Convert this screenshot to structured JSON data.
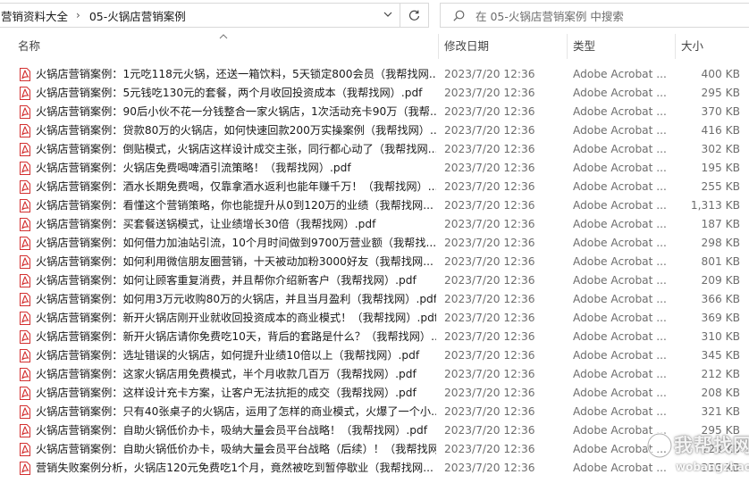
{
  "address_bar": {
    "segments": [
      "营销资料大全",
      "05-火锅店营销案例"
    ],
    "separator": "›"
  },
  "search": {
    "placeholder": "在 05-火锅店营销案例 中搜索"
  },
  "columns": {
    "name": "名称",
    "date": "修改日期",
    "type": "类型",
    "size": "大小"
  },
  "colors": {
    "pdf_icon": "#d32f2f",
    "header_text": "#444444",
    "meta_text": "#6d6d6d"
  },
  "files": [
    {
      "name": "火锅店营销案例：1元吃118元火锅，还送一箱饮料，5天锁定800会员（我帮找网...",
      "date": "2023/7/20 12:36",
      "type": "Adobe Acrobat ...",
      "size": "400 KB"
    },
    {
      "name": "火锅店营销案例：5元钱吃130元的套餐，两个月收回投资成本（我帮找网）.pdf",
      "date": "2023/7/20 12:36",
      "type": "Adobe Acrobat ...",
      "size": "295 KB"
    },
    {
      "name": "火锅店营销案例：90后小伙不花一分钱整合一家火锅店，1次活动充卡90万（我帮...",
      "date": "2023/7/20 12:36",
      "type": "Adobe Acrobat ...",
      "size": "370 KB"
    },
    {
      "name": "火锅店营销案例：贷款80万的火锅店，如何快速回款200万实操案例（我帮找网）....",
      "date": "2023/7/20 12:36",
      "type": "Adobe Acrobat ...",
      "size": "416 KB"
    },
    {
      "name": "火锅店营销案例：倒贴模式，火锅店这样设计成交主张，同行都心动了（我帮找网...",
      "date": "2023/7/20 12:36",
      "type": "Adobe Acrobat ...",
      "size": "302 KB"
    },
    {
      "name": "火锅店营销案例：火锅店免费喝啤酒引流策略！（我帮找网）.pdf",
      "date": "2023/7/20 12:36",
      "type": "Adobe Acrobat ...",
      "size": "195 KB"
    },
    {
      "name": "火锅店营销案例：酒水长期免费喝，仅靠拿酒水返利也能年赚千万！（我帮找网）...",
      "date": "2023/7/20 12:36",
      "type": "Adobe Acrobat ...",
      "size": "255 KB"
    },
    {
      "name": "火锅店营销案例：看懂这个营销策略，你也能提升从0到120万的业绩（我帮找网...",
      "date": "2023/7/20 12:36",
      "type": "Adobe Acrobat ...",
      "size": "1,313 KB"
    },
    {
      "name": "火锅店营销案例：买套餐送锅模式，让业绩增长30倍（我帮找网）.pdf",
      "date": "2023/7/20 12:36",
      "type": "Adobe Acrobat ...",
      "size": "187 KB"
    },
    {
      "name": "火锅店营销案例：如何借力加油站引流，10个月时间做到9700万营业额（我帮找...",
      "date": "2023/7/20 12:36",
      "type": "Adobe Acrobat ...",
      "size": "298 KB"
    },
    {
      "name": "火锅店营销案例：如何利用微信朋友圈营销，十天被动加粉3000好友（我帮找网...",
      "date": "2023/7/20 12:36",
      "type": "Adobe Acrobat ...",
      "size": "801 KB"
    },
    {
      "name": "火锅店营销案例：如何让顾客重复消费，并且帮你介绍新客户（我帮找网）.pdf",
      "date": "2023/7/20 12:36",
      "type": "Adobe Acrobat ...",
      "size": "209 KB"
    },
    {
      "name": "火锅店营销案例：如何用3万元收购80万的火锅店，并且当月盈利（我帮找网）.pdf",
      "date": "2023/7/20 12:36",
      "type": "Adobe Acrobat ...",
      "size": "366 KB"
    },
    {
      "name": "火锅店营销案例：新开火锅店刚开业就收回投资成本的商业模式！（我帮找网）.pdf",
      "date": "2023/7/20 12:36",
      "type": "Adobe Acrobat ...",
      "size": "369 KB"
    },
    {
      "name": "火锅店营销案例：新开火锅店请你免费吃10天，背后的套路是什么？（我帮找网）...",
      "date": "2023/7/20 12:36",
      "type": "Adobe Acrobat ...",
      "size": "310 KB"
    },
    {
      "name": "火锅店营销案例：选址错误的火锅店，如何提升业绩10倍以上（我帮找网）.pdf",
      "date": "2023/7/20 12:36",
      "type": "Adobe Acrobat ...",
      "size": "345 KB"
    },
    {
      "name": "火锅店营销案例：这家火锅店用免费模式，半个月收款几百万（我帮找网）.pdf",
      "date": "2023/7/20 12:36",
      "type": "Adobe Acrobat ...",
      "size": "212 KB"
    },
    {
      "name": "火锅店营销案例：这样设计充卡方案，让客户无法抗拒的成交（我帮找网）.pdf",
      "date": "2023/7/20 12:36",
      "type": "Adobe Acrobat ...",
      "size": "208 KB"
    },
    {
      "name": "火锅店营销案例：只有40张桌子的火锅店，运用了怎样的商业模式，火爆了一个小...",
      "date": "2023/7/20 12:36",
      "type": "Adobe Acrobat ...",
      "size": "321 KB"
    },
    {
      "name": "火锅店营销案例：自助火锅低价办卡，吸纳大量会员平台战略！（我帮找网）.pdf",
      "date": "2023/7/20 12:36",
      "type": "Adobe Acrobat ...",
      "size": "295 KB"
    },
    {
      "name": "火锅店营销案例：自助火锅低价办卡，吸纳大量会员平台战略（后续）！（我帮找网...",
      "date": "2023/7/20 12:36",
      "type": "Adobe Acrobat ...",
      "size": "228 KB"
    },
    {
      "name": "营销失败案例分析，火锅店120元免费吃1个月，竟然被吃到暂停歇业（我帮找网...",
      "date": "2023/7/20 12:36",
      "type": "Adobe Acrobat ...",
      "size": "355 KB"
    }
  ],
  "watermark": {
    "text": "我帮找网",
    "url": "wobangzhao.com"
  }
}
